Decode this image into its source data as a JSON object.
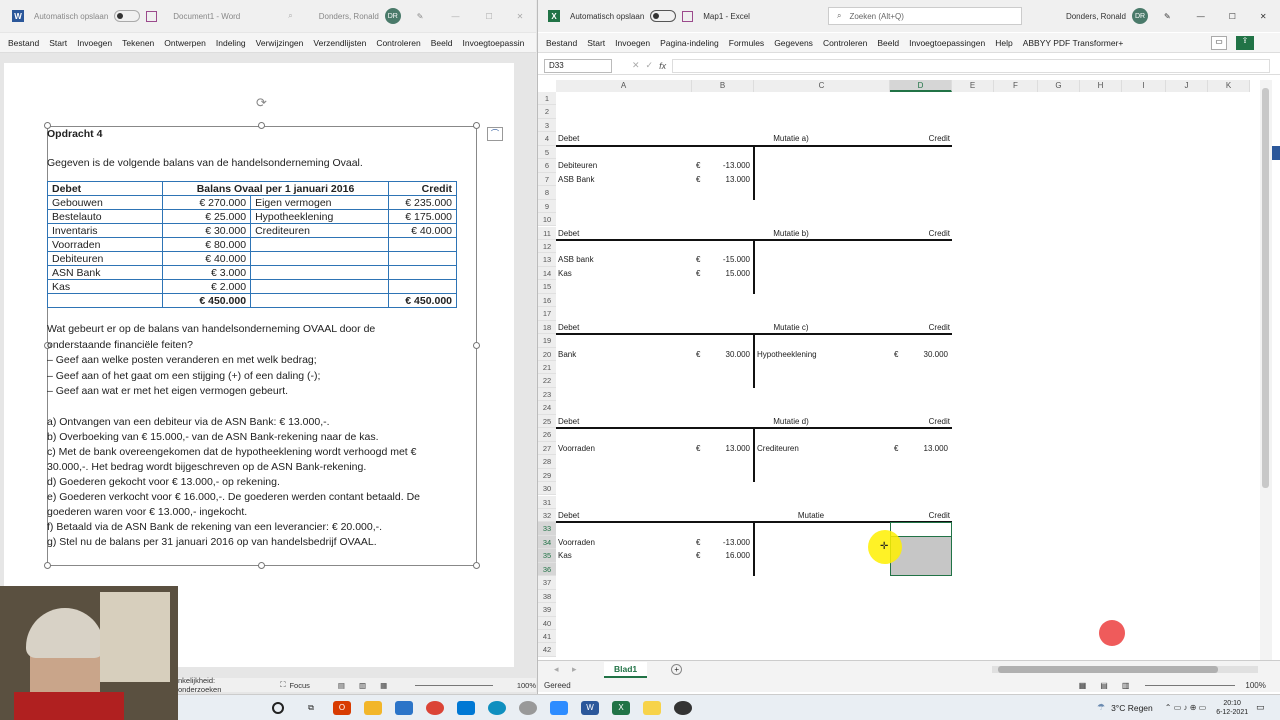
{
  "word": {
    "autosave_label": "Automatisch opslaan",
    "doc_title": "Document1 - Word",
    "user": "Donders, Ronald",
    "user_initials": "DR",
    "ribbon_tabs": [
      "Bestand",
      "Start",
      "Invoegen",
      "Tekenen",
      "Ontwerpen",
      "Indeling",
      "Verwijzingen",
      "Verzendlijsten",
      "Controleren",
      "Beeld",
      "Invoegtoepassin"
    ],
    "title": "Opdracht 4",
    "intro": "Gegeven is de volgende balans van de handelsonderneming Ovaal.",
    "balance": {
      "header": {
        "debet": "Debet",
        "title": "Balans Ovaal per 1 januari 2016",
        "credit": "Credit"
      },
      "rows": [
        [
          "Gebouwen",
          "€ 270.000",
          "Eigen vermogen",
          "€ 235.000"
        ],
        [
          "Bestelauto",
          "€ 25.000",
          "Hypotheeklening",
          "€ 175.000"
        ],
        [
          "Inventaris",
          "€ 30.000",
          "Crediteuren",
          "€ 40.000"
        ],
        [
          "Voorraden",
          "€ 80.000",
          "",
          ""
        ],
        [
          "Debiteuren",
          "€ 40.000",
          "",
          ""
        ],
        [
          "ASN Bank",
          "€ 3.000",
          "",
          ""
        ],
        [
          "Kas",
          "€ 2.000",
          "",
          ""
        ]
      ],
      "totals": [
        "€ 450.000",
        "€ 450.000"
      ]
    },
    "question_lines": [
      "Wat gebeurt er op de balans van handelsonderneming OVAAL door de",
      "onderstaande financiële feiten?",
      "–   Geef aan welke posten veranderen en met welk bedrag;",
      "–   Geef aan of het gaat om een stijging (+) of een daling (-);",
      "–   Geef aan wat er met het eigen vermogen gebeurt."
    ],
    "items": [
      "a) Ontvangen van een debiteur via de ASN Bank: € 13.000,-.",
      "b) Overboeking van € 15.000,- van de ASN Bank-rekening naar de kas.",
      "c)  Met de bank overeengekomen dat de hypotheeklening wordt verhoogd met €",
      "      30.000,-. Het bedrag wordt bijgeschreven op de ASN Bank-rekening.",
      "d) Goederen gekocht voor € 13.000,- op rekening.",
      "e) Goederen verkocht voor € 16.000,-. De goederen werden contant betaald. De",
      "      goederen waren voor € 13.000,- ingekocht.",
      "f)  Betaald via de ASN Bank de rekening van een leverancier: € 20.000,-.",
      "g) Stel nu de balans per 31 januari 2016 op van handelsbedrijf OVAAL."
    ],
    "status": {
      "accessibility": "nkelijkheid: onderzoeken",
      "focus": "Focus",
      "zoom": "100%"
    }
  },
  "excel": {
    "autosave_label": "Automatisch opslaan",
    "doc_title": "Map1 - Excel",
    "search_placeholder": "Zoeken (Alt+Q)",
    "user": "Donders, Ronald",
    "user_initials": "DR",
    "ribbon_tabs": [
      "Bestand",
      "Start",
      "Invoegen",
      "Pagina-indeling",
      "Formules",
      "Gegevens",
      "Controleren",
      "Beeld",
      "Invoegtoepassingen",
      "Help",
      "ABBYY PDF Transformer+"
    ],
    "name_box": "D33",
    "columns": [
      "A",
      "B",
      "C",
      "D",
      "E",
      "F",
      "G",
      "H",
      "I",
      "J",
      "K"
    ],
    "sheet_tab": "Blad1",
    "status": "Gereed",
    "zoom": "100%",
    "blocks": [
      {
        "title": "Mutatie a)",
        "header_row": 4,
        "rows": [
          {
            "row": 6,
            "left": "Debiteuren",
            "lcur": "€",
            "lval": "-13.000"
          },
          {
            "row": 7,
            "left": "ASB Bank",
            "lcur": "€",
            "lval": "13.000"
          }
        ]
      },
      {
        "title": "Mutatie b)",
        "header_row": 11,
        "rows": [
          {
            "row": 13,
            "left": "ASB bank",
            "lcur": "€",
            "lval": "-15.000"
          },
          {
            "row": 14,
            "left": "Kas",
            "lcur": "€",
            "lval": "15.000"
          }
        ]
      },
      {
        "title": "Mutatie c)",
        "header_row": 18,
        "rows": [
          {
            "row": 20,
            "left": "Bank",
            "lcur": "€",
            "lval": "30.000",
            "right": "Hypotheeklening",
            "rcur": "€",
            "rval": "30.000"
          }
        ]
      },
      {
        "title": "Mutatie d)",
        "header_row": 25,
        "rows": [
          {
            "row": 27,
            "left": "Voorraden",
            "lcur": "€",
            "lval": "13.000",
            "right": "Crediteuren",
            "rcur": "€",
            "rval": "13.000"
          }
        ]
      },
      {
        "title": "Mutatie",
        "header_row": 32,
        "rows": [
          {
            "row": 34,
            "left": "Voorraden",
            "lcur": "€",
            "lval": "-13.000"
          },
          {
            "row": 35,
            "left": "Kas",
            "lcur": "€",
            "lval": "16.000"
          }
        ]
      }
    ],
    "debet_label": "Debet",
    "credit_label": "Credit"
  },
  "taskbar": {
    "weather": "3°C  Regen",
    "time": "20:10",
    "date": "6-12-2021"
  }
}
